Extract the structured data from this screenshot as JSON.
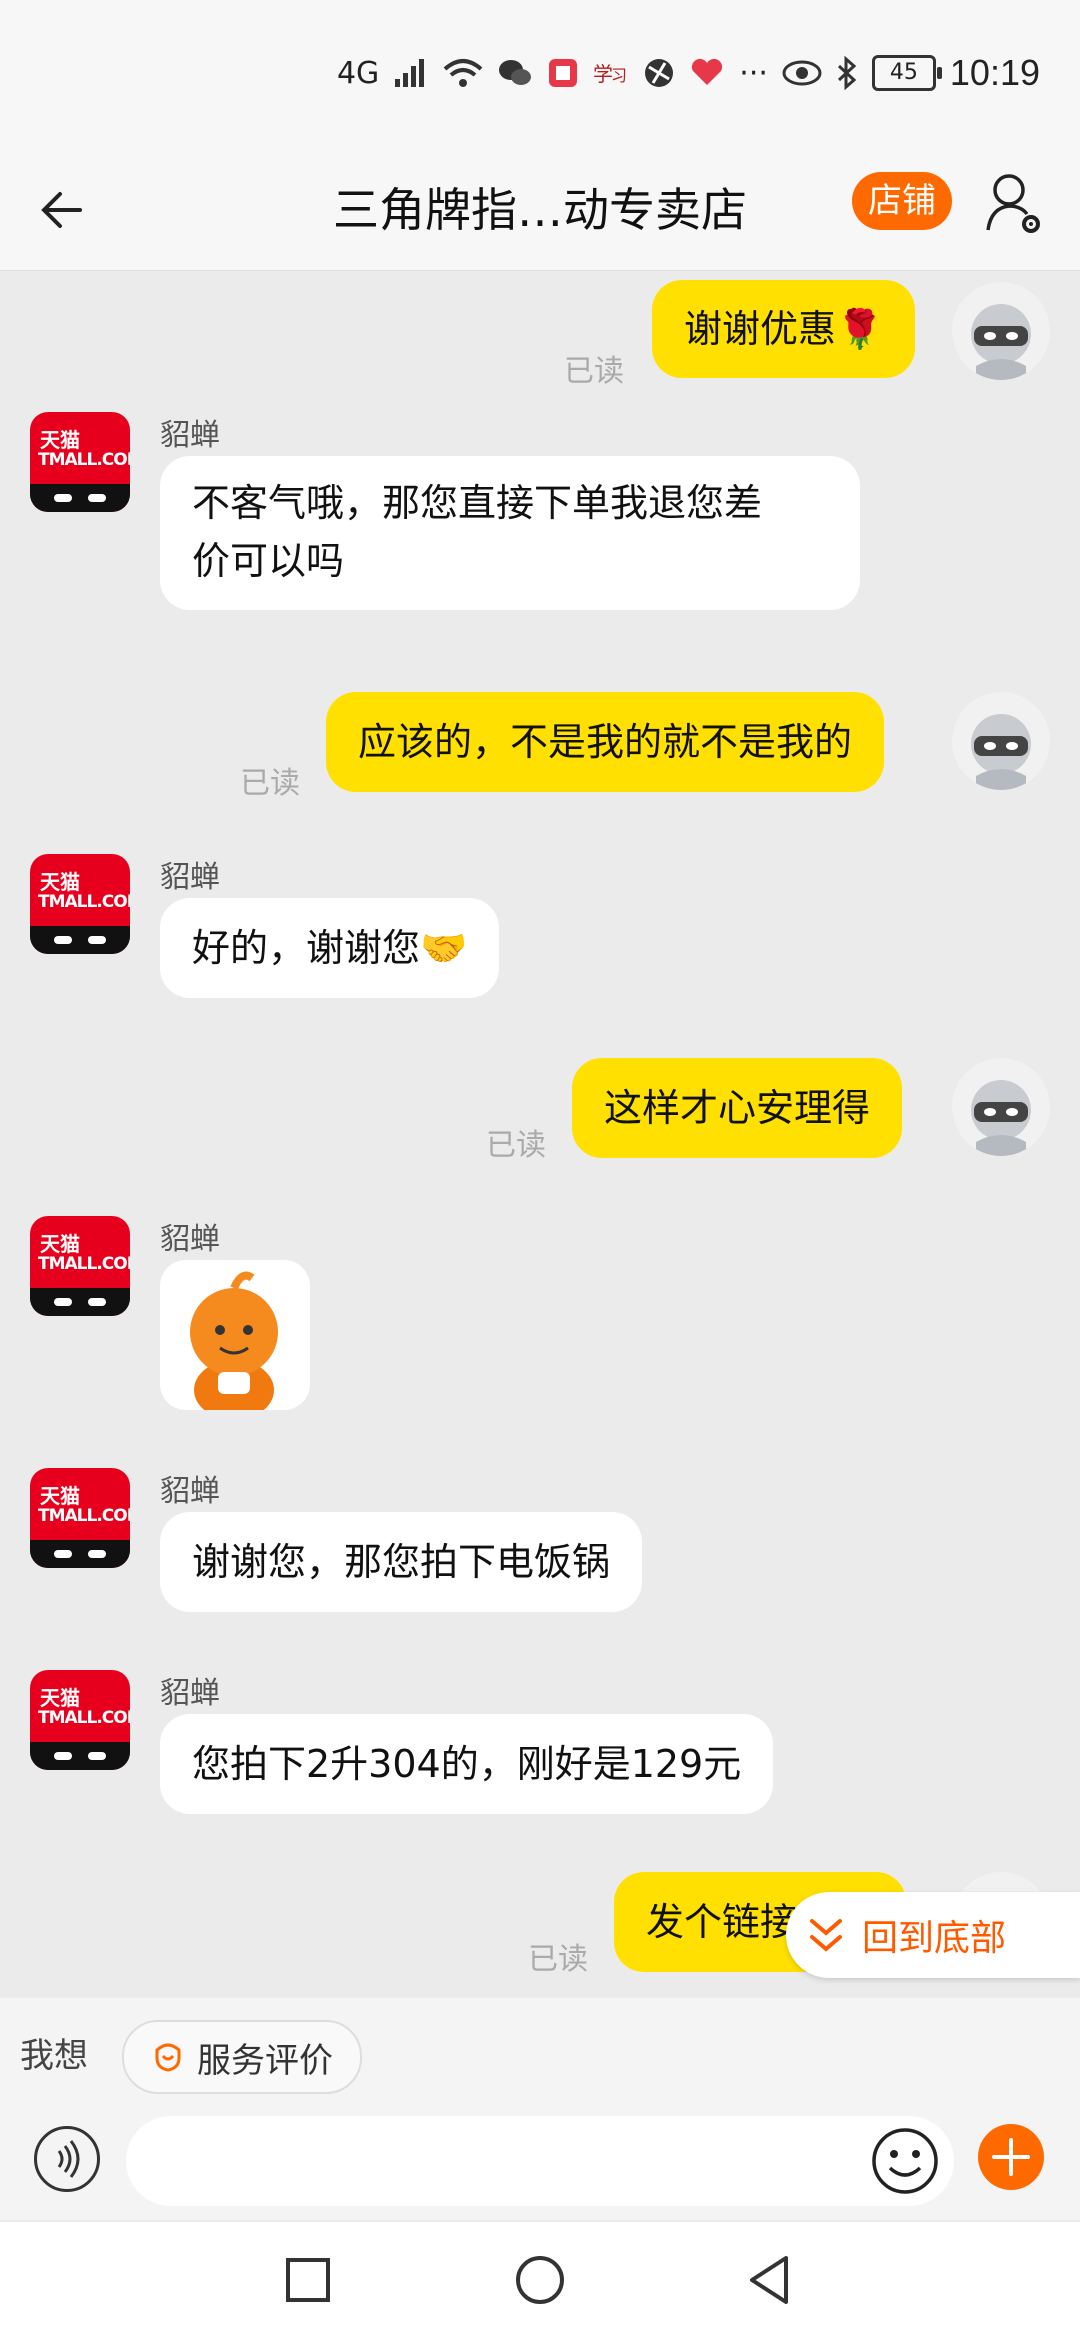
{
  "status_bar": {
    "network": "4G",
    "battery": "45",
    "time": "10:19",
    "more": "···"
  },
  "header": {
    "title": "三角牌指…动专卖店",
    "shop_button": "店铺"
  },
  "messages": [
    {
      "side": "me",
      "text": "谢谢优惠🌹",
      "read": "已读"
    },
    {
      "side": "them",
      "name": "貂蝉",
      "line1": "不客气哦，那您直接下单我退您差",
      "line2": "价可以吗"
    },
    {
      "side": "me",
      "text": "应该的，不是我的就不是我的",
      "read": "已读"
    },
    {
      "side": "them",
      "name": "貂蝉",
      "text": "好的，谢谢您🤝"
    },
    {
      "side": "me",
      "text": "这样才心安理得",
      "read": "已读"
    },
    {
      "side": "them",
      "name": "貂蝉",
      "type": "sticker"
    },
    {
      "side": "them",
      "name": "貂蝉",
      "text": "谢谢您，那您拍下电饭锅"
    },
    {
      "side": "them",
      "name": "貂蝉",
      "text": "您拍下2升304的，刚好是129元"
    },
    {
      "side": "me",
      "text": "发个链接过来",
      "read": "已读"
    }
  ],
  "shop_avatar": {
    "line1": "天猫",
    "line2": "TMALL.COM"
  },
  "scroll_to_bottom": "回到底部",
  "bottom_bar": {
    "want_label": "我想",
    "service_chip": "服务评价",
    "input_placeholder": ""
  },
  "icons": {
    "back": "arrow-left-icon",
    "user_settings": "user-gear-icon",
    "voice": "voice-icon",
    "emoji": "smiley-icon",
    "plus": "plus-icon"
  },
  "colors": {
    "accent": "#ff6a00",
    "my_bubble": "#ffe000",
    "their_bubble": "#ffffff"
  }
}
